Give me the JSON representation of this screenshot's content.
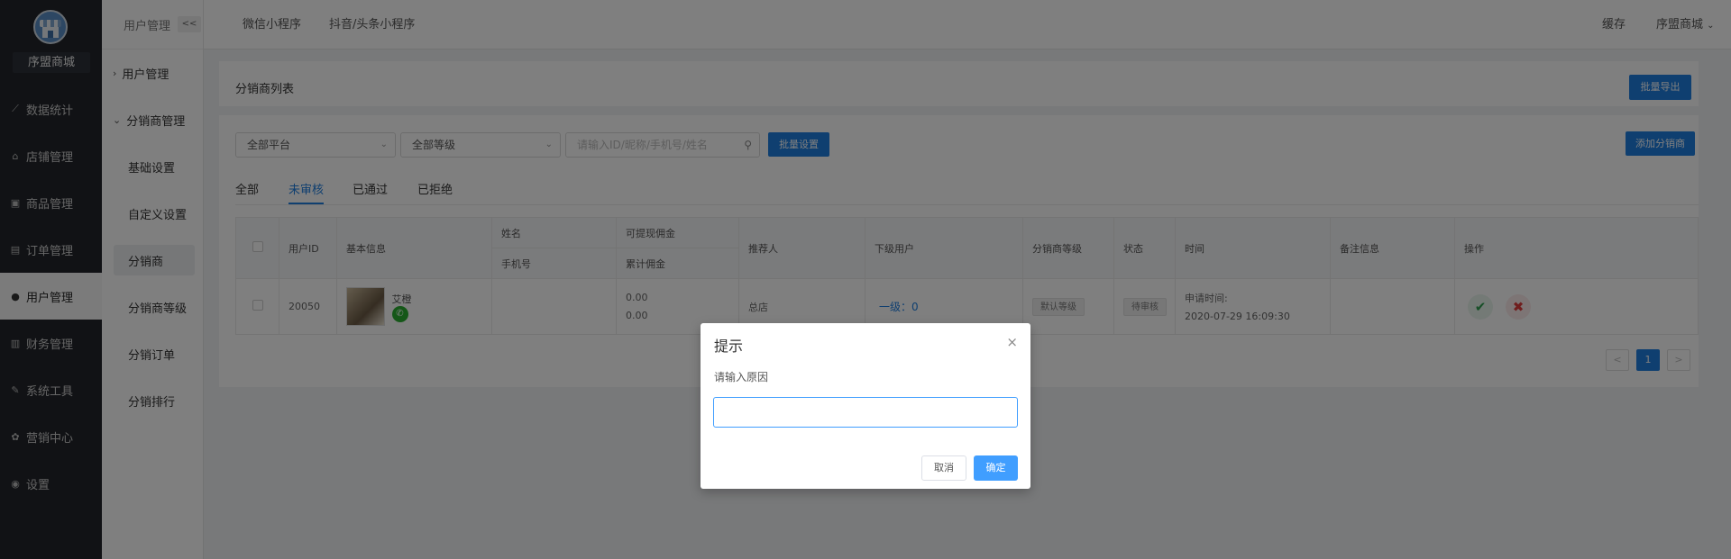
{
  "sidebar": {
    "shop_name": "序盟商城",
    "items": [
      {
        "icon": "line-chart-icon",
        "glyph": "⟋",
        "label": "数据统计"
      },
      {
        "icon": "store-icon",
        "glyph": "⌂",
        "label": "店铺管理"
      },
      {
        "icon": "goods-icon",
        "glyph": "▣",
        "label": "商品管理"
      },
      {
        "icon": "order-icon",
        "glyph": "▤",
        "label": "订单管理"
      },
      {
        "icon": "user-icon",
        "glyph": "●",
        "label": "用户管理"
      },
      {
        "icon": "finance-icon",
        "glyph": "▥",
        "label": "财务管理"
      },
      {
        "icon": "wrench-icon",
        "glyph": "✎",
        "label": "系统工具"
      },
      {
        "icon": "marketing-icon",
        "glyph": "✿",
        "label": "营销中心"
      },
      {
        "icon": "settings-icon",
        "glyph": "◉",
        "label": "设置"
      }
    ]
  },
  "submenu": {
    "header": "用户管理",
    "collapse_label": "<<",
    "group1": "用户管理",
    "group2": "分销商管理",
    "items": [
      "基础设置",
      "自定义设置",
      "分销商",
      "分销商等级",
      "分销订单",
      "分销排行"
    ]
  },
  "topbar": {
    "tab1": "微信小程序",
    "tab2": "抖音/头条小程序",
    "cache": "缓存",
    "user": "序盟商城"
  },
  "page": {
    "title": "分销商列表",
    "export_btn": "批量导出",
    "platform_select": "全部平台",
    "level_select": "全部等级",
    "search_placeholder": "请输入ID/昵称/手机号/姓名",
    "batch_btn": "批量设置",
    "add_btn": "添加分销商",
    "tabs": [
      "全部",
      "未审核",
      "已通过",
      "已拒绝"
    ]
  },
  "table": {
    "headers": {
      "user_id": "用户ID",
      "basic": "基本信息",
      "name": "姓名",
      "phone": "手机号",
      "withdrawable": "可提现佣金",
      "total": "累计佣金",
      "referrer": "推荐人",
      "subordinates": "下级用户",
      "level": "分销商等级",
      "status": "状态",
      "time": "时间",
      "remark": "备注信息",
      "ops": "操作"
    },
    "row": {
      "user_id": "20050",
      "nickname": "艾橙",
      "withdrawable": "0.00",
      "total": "0.00",
      "referrer": "总店",
      "subordinates": "一级：0",
      "level": "默认等级",
      "status": "待审核",
      "time_label": "申请时间:",
      "time_value": "2020-07-29 16:09:30",
      "approve_glyph": "✔",
      "reject_glyph": "✖"
    }
  },
  "pagination": {
    "prev": "<",
    "current": "1",
    "next": ">"
  },
  "dialog": {
    "title": "提示",
    "close": "×",
    "label": "请输入原因",
    "input_value": "",
    "cancel": "取消",
    "confirm": "确定"
  }
}
